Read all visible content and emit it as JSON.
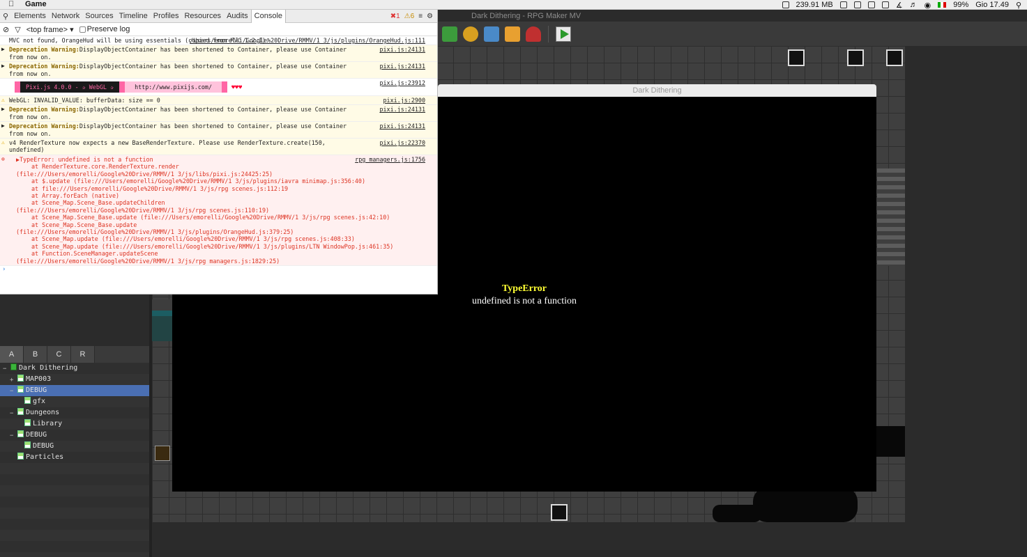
{
  "menubar": {
    "apple_icon": "apple-icon",
    "app_name": "Game",
    "memory": "239.91 MB",
    "flag": "IT",
    "battery": "99%",
    "clock": "Gio 17.49"
  },
  "rpgmaker": {
    "title": "Dark Dithering - RPG Maker MV"
  },
  "game_window": {
    "title": "Dark Dithering",
    "error_title": "TypeError",
    "error_message": "undefined is not a function"
  },
  "devtools": {
    "tabs": [
      "Elements",
      "Network",
      "Sources",
      "Timeline",
      "Profiles",
      "Resources",
      "Audits",
      "Console"
    ],
    "error_count": "1",
    "warning_count": "6",
    "frame_selector": "<top frame>",
    "preserve_log": "Preserve log",
    "messages": [
      {
        "type": "log",
        "text": "MVC not found, OrangeHud will be using essentials (copied from MVC 1.2.1).",
        "source": "/Users/emorelli/Google%20Drive/RMMV/1 3/js/plugins/OrangeHud.js:111"
      },
      {
        "type": "deprecation",
        "label": "Deprecation Warning:",
        "text": "DisplayObjectContainer has been shortened to Container, please use Container from now on.",
        "source": "pixi.js:24131"
      },
      {
        "type": "deprecation",
        "label": "Deprecation Warning:",
        "text": "DisplayObjectContainer has been shortened to Container, please use Container from now on.",
        "source": "pixi.js:24131"
      },
      {
        "type": "banner",
        "source": "pixi.js:23912"
      },
      {
        "type": "warn",
        "text": "WebGL: INVALID_VALUE: bufferData: size == 0",
        "source": "pixi.js:2900"
      },
      {
        "type": "deprecation",
        "label": "Deprecation Warning:",
        "text": "DisplayObjectContainer has been shortened to Container, please use Container from now on.",
        "source": "pixi.js:24131"
      },
      {
        "type": "deprecation",
        "label": "Deprecation Warning:",
        "text": "DisplayObjectContainer has been shortened to Container, please use Container from now on.",
        "source": "pixi.js:24131"
      },
      {
        "type": "warn",
        "text": "v4 RenderTexture now expects a new BaseRenderTexture. Please use RenderTexture.create(150, undefined)",
        "source": "pixi.js:22370"
      }
    ],
    "pixi_banner": {
      "name": "Pixi.js 4.0.0 - ✰ WebGL ✰",
      "url": "http://www.pixijs.com/",
      "hearts": "♥♥♥"
    },
    "error": {
      "text": "▶TypeError: undefined is not a function",
      "source": "rpg_managers.js:1756",
      "stack": [
        {
          "cont": false,
          "text": "at RenderTexture.core.RenderTexture.render"
        },
        {
          "cont": true,
          "text": "(file:///Users/emorelli/Google%20Drive/RMMV/1 3/js/libs/pixi.js:24425:25)"
        },
        {
          "cont": false,
          "text": "at $.update (file:///Users/emorelli/Google%20Drive/RMMV/1 3/js/plugins/iavra minimap.js:356:40)"
        },
        {
          "cont": false,
          "text": "at file:///Users/emorelli/Google%20Drive/RMMV/1 3/js/rpg scenes.js:112:19"
        },
        {
          "cont": false,
          "text": "at Array.forEach (native)"
        },
        {
          "cont": false,
          "text": "at Scene_Map.Scene_Base.updateChildren"
        },
        {
          "cont": true,
          "text": "(file:///Users/emorelli/Google%20Drive/RMMV/1 3/js/rpg scenes.js:110:19)"
        },
        {
          "cont": false,
          "text": "at Scene_Map.Scene_Base.update (file:///Users/emorelli/Google%20Drive/RMMV/1 3/js/rpg scenes.js:42:10)"
        },
        {
          "cont": false,
          "text": "at Scene_Map.Scene_Base.update"
        },
        {
          "cont": true,
          "text": "(file:///Users/emorelli/Google%20Drive/RMMV/1 3/js/plugins/OrangeHud.js:379:25)"
        },
        {
          "cont": false,
          "text": "at Scene_Map.update (file:///Users/emorelli/Google%20Drive/RMMV/1 3/js/rpg scenes.js:408:33)"
        },
        {
          "cont": false,
          "text": "at Scene_Map.update (file:///Users/emorelli/Google%20Drive/RMMV/1 3/js/plugins/LTN WindowPop.js:461:35)"
        },
        {
          "cont": false,
          "text": "at Function.SceneManager.updateScene"
        },
        {
          "cont": true,
          "text": "(file:///Users/emorelli/Google%20Drive/RMMV/1 3/js/rpg managers.js:1829:25)"
        }
      ]
    },
    "prompt": "›"
  },
  "left_panel": {
    "layer_tabs": [
      "A",
      "B",
      "C",
      "R"
    ],
    "tree": [
      {
        "label": "Dark Dithering",
        "indent": 0,
        "toggle": "−",
        "icon": "book",
        "selected": false
      },
      {
        "label": "MAP003",
        "indent": 1,
        "toggle": "+",
        "icon": "map",
        "selected": false
      },
      {
        "label": "DEBUG",
        "indent": 1,
        "toggle": "−",
        "icon": "map",
        "selected": true
      },
      {
        "label": "gfx",
        "indent": 2,
        "toggle": "",
        "icon": "map",
        "selected": false
      },
      {
        "label": "Dungeons",
        "indent": 1,
        "toggle": "−",
        "icon": "map",
        "selected": false
      },
      {
        "label": "Library",
        "indent": 2,
        "toggle": "",
        "icon": "map",
        "selected": false
      },
      {
        "label": "DEBUG",
        "indent": 1,
        "toggle": "−",
        "icon": "map",
        "selected": false
      },
      {
        "label": "DEBUG",
        "indent": 2,
        "toggle": "",
        "icon": "map",
        "selected": false
      },
      {
        "label": "Particles",
        "indent": 1,
        "toggle": "",
        "icon": "map",
        "selected": false
      }
    ]
  },
  "colors": {
    "error_title": "#ffff33",
    "selection": "#4a6fb3",
    "pixi_pink": "#ff66a5"
  }
}
